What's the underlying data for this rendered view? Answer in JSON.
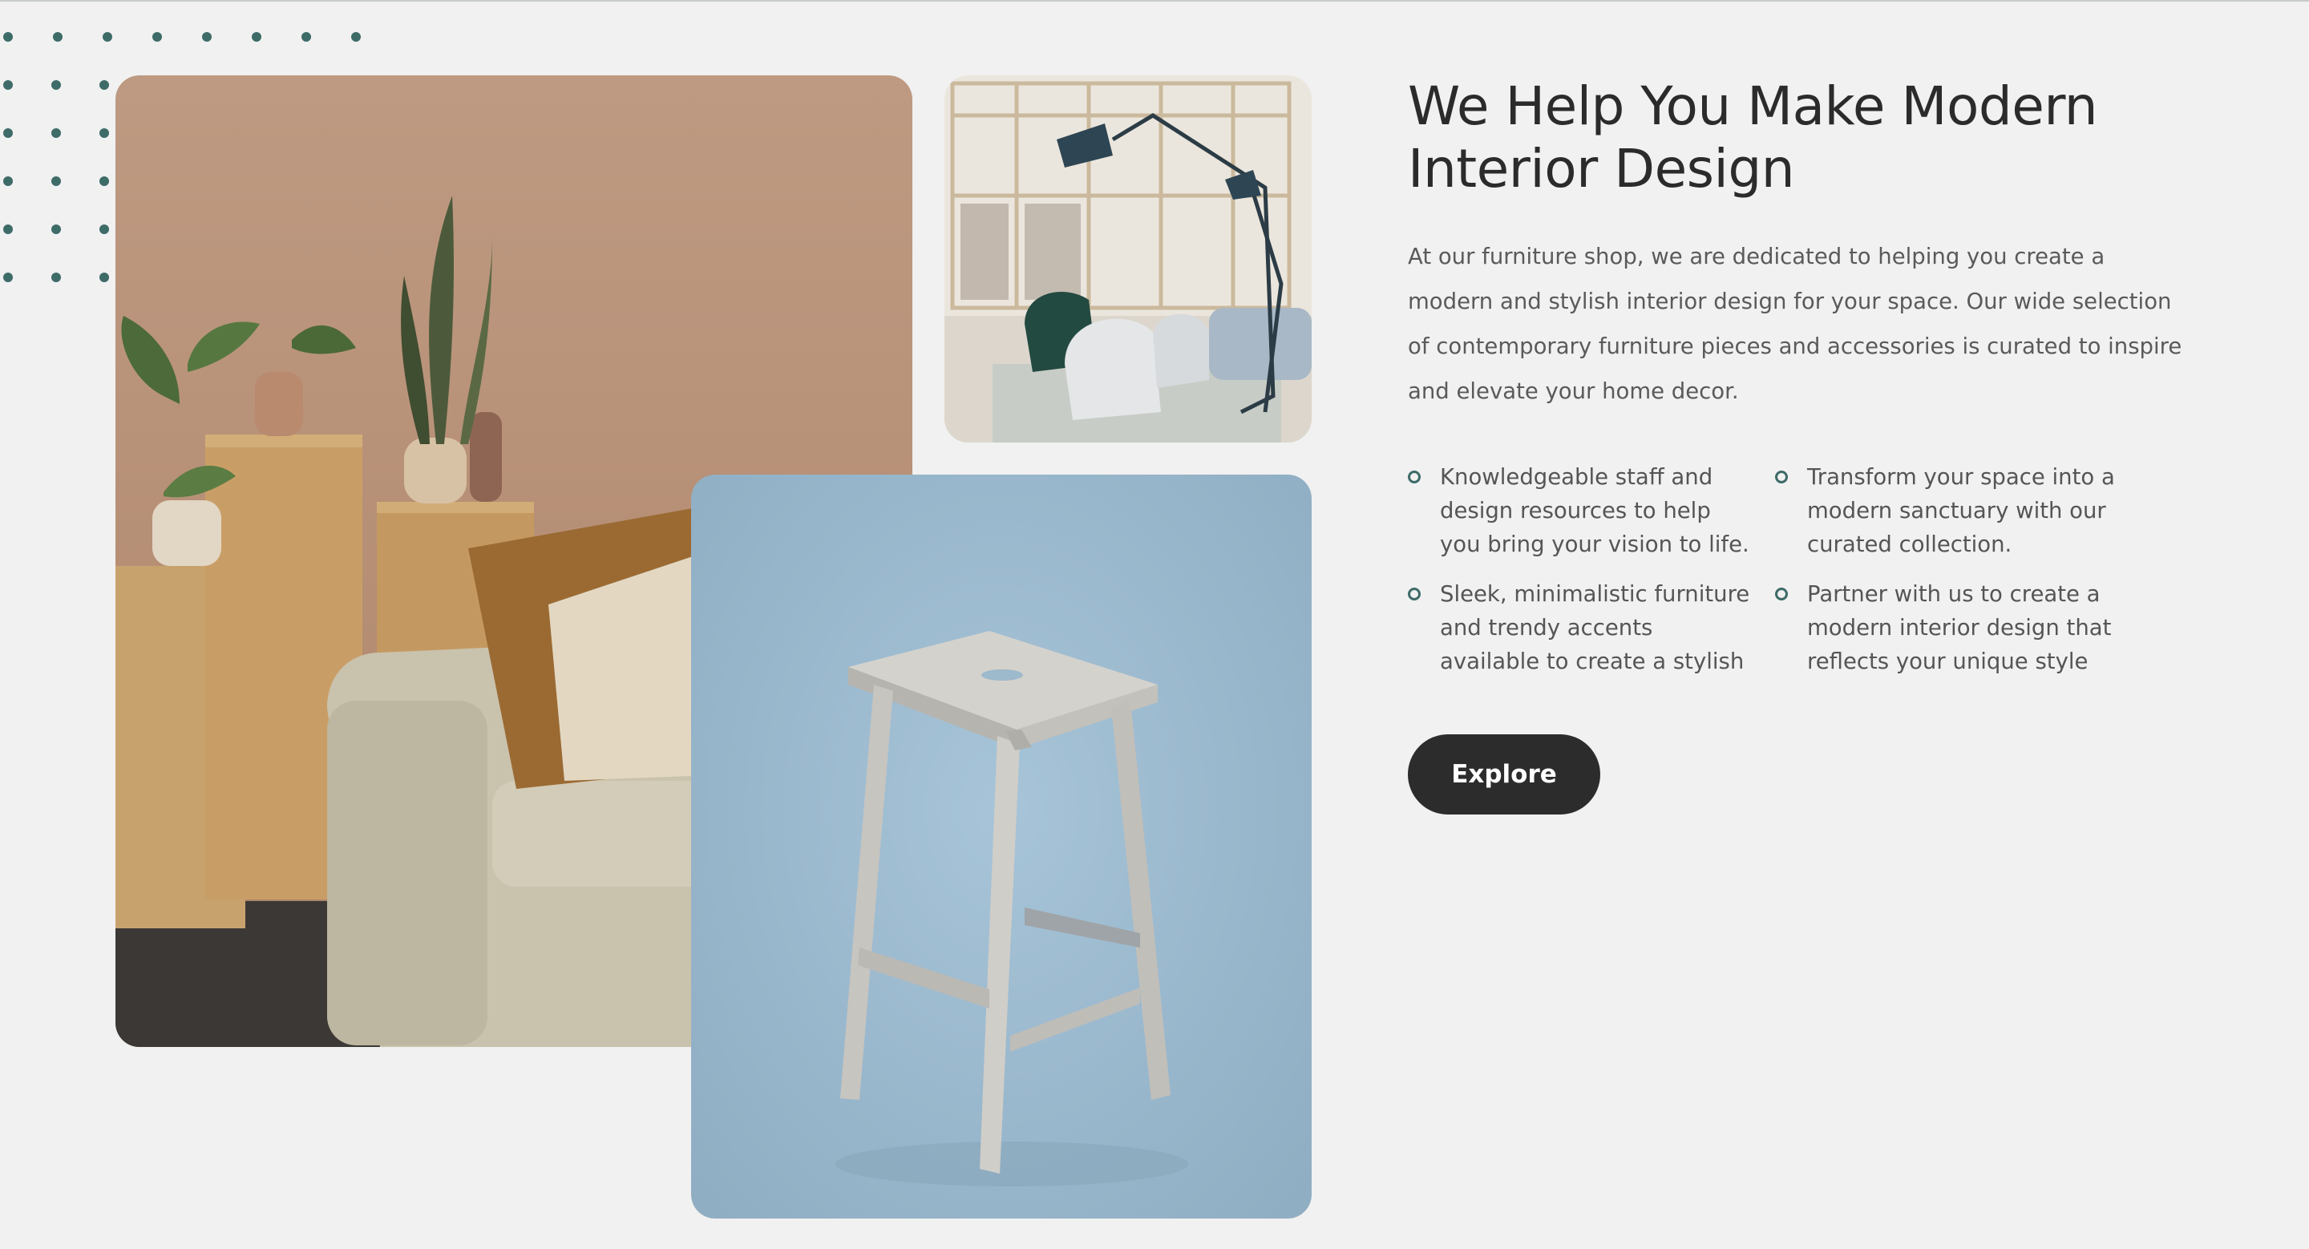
{
  "section": {
    "title": "We Help You Make Modern Interior Design",
    "description": "At our furniture shop, we are dedicated to helping you create a modern and stylish interior design for your space. Our wide selection of contemporary furniture pieces and accessories is curated to inspire and elevate your home decor.",
    "features": [
      "Knowledgeable staff and design resources to help you bring your vision to life.",
      "Transform your space into a modern sanctuary with our curated collection.",
      "Sleek, minimalistic furniture and trendy accents available to create a stylish",
      "Partner with us to create a modern interior design that reflects your unique style"
    ],
    "cta_label": "Explore"
  },
  "colors": {
    "background": "#f0f1f0",
    "accent": "#3d6b68",
    "button": "#2c2c2c",
    "heading": "#2b2b2b",
    "body_text": "#5a5a5a"
  }
}
